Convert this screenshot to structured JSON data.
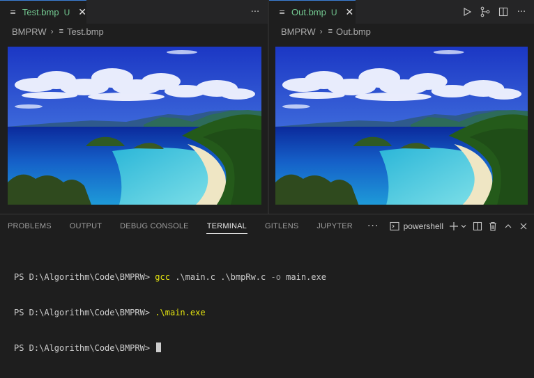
{
  "editors": {
    "left": {
      "tab": {
        "icon": "file-lines-icon",
        "label": "Test.bmp",
        "badge": "U",
        "close_icon": "close-icon"
      },
      "actions": [
        {
          "icon": "more-icon",
          "glyph": "···"
        }
      ],
      "breadcrumb": {
        "folder": "BMPRW",
        "file": "Test.bmp"
      }
    },
    "right": {
      "tab": {
        "icon": "file-lines-icon",
        "label": "Out.bmp",
        "badge": "U",
        "close_icon": "close-icon"
      },
      "actions": [
        {
          "icon": "run-icon"
        },
        {
          "icon": "source-control-icon"
        },
        {
          "icon": "split-editor-icon"
        },
        {
          "icon": "more-icon",
          "glyph": "···"
        }
      ],
      "breadcrumb": {
        "folder": "BMPRW",
        "file": "Out.bmp"
      }
    }
  },
  "panel": {
    "tabs": [
      "PROBLEMS",
      "OUTPUT",
      "DEBUG CONSOLE",
      "TERMINAL",
      "GITLENS",
      "JUPYTER"
    ],
    "active_tab": "TERMINAL",
    "more": "···",
    "shell": "powershell",
    "actions": [
      "new-terminal-icon",
      "chevron-down-icon",
      "split-terminal-icon",
      "trash-icon",
      "chevron-up-icon",
      "close-icon"
    ]
  },
  "terminal": {
    "lines": [
      {
        "prompt": "PS D:\\Algorithm\\Code\\BMPRW> ",
        "cmd": "gcc",
        "args": " .\\main.c .\\bmpRw.c ",
        "flag": "-o",
        "rest": " main.exe"
      },
      {
        "prompt": "PS D:\\Algorithm\\Code\\BMPRW> ",
        "cmd": ".\\main.exe",
        "args": "",
        "flag": "",
        "rest": ""
      },
      {
        "prompt": "PS D:\\Algorithm\\Code\\BMPRW> ",
        "cmd": "",
        "args": "",
        "flag": "",
        "rest": ""
      }
    ]
  },
  "colors": {
    "accent": "#3c7fd6",
    "modified": "#73c991",
    "command": "#e5e510",
    "background": "#1e1e1e"
  }
}
